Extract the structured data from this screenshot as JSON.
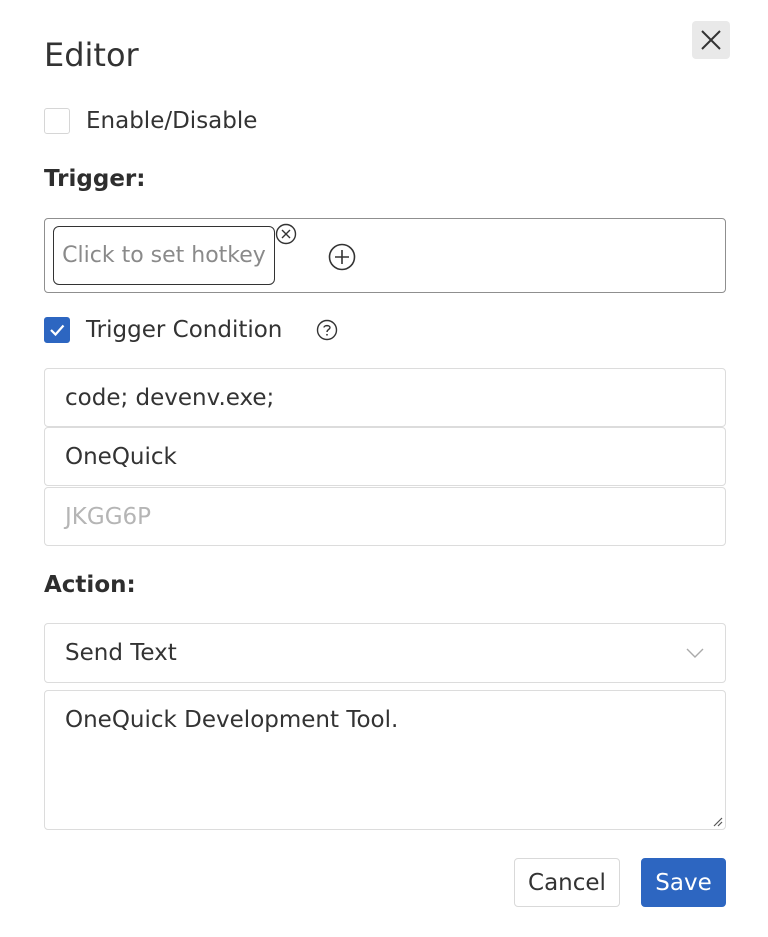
{
  "dialog": {
    "title": "Editor",
    "close_icon": "close-icon"
  },
  "enable": {
    "label": "Enable/Disable",
    "checked": false
  },
  "trigger": {
    "label": "Trigger:",
    "hotkey_placeholder": "Click to set hotkey",
    "remove_icon": "circle-x-icon",
    "add_icon": "circle-plus-icon"
  },
  "condition": {
    "label": "Trigger Condition",
    "checked": true,
    "help_icon": "question-circle-icon",
    "fields": [
      {
        "value": "code; devenv.exe;",
        "placeholder": ""
      },
      {
        "value": "OneQuick",
        "placeholder": ""
      },
      {
        "value": "",
        "placeholder": "JKGG6P"
      }
    ]
  },
  "action": {
    "label": "Action:",
    "selected": "Send Text",
    "dropdown_icon": "chevron-down-icon",
    "text": "OneQuick Development Tool."
  },
  "footer": {
    "cancel_label": "Cancel",
    "save_label": "Save"
  },
  "colors": {
    "accent": "#2d66c1",
    "close_bg": "#e9e9e9"
  }
}
